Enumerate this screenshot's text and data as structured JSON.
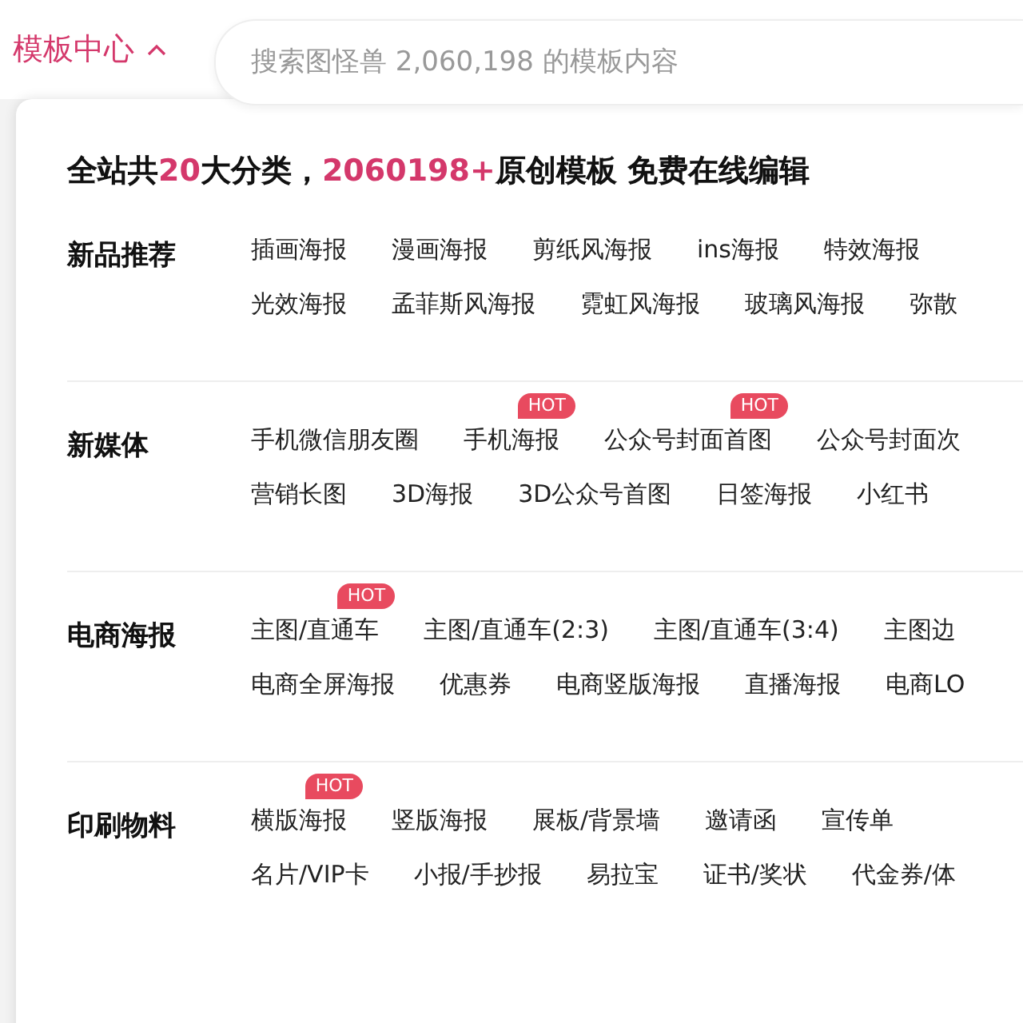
{
  "nav": {
    "label": "模板中心",
    "expanded": true
  },
  "search": {
    "placeholder": "搜索图怪兽 2,060,198 的模板内容"
  },
  "headline": [
    {
      "text": "全站共",
      "highlight": false
    },
    {
      "text": "20",
      "highlight": true
    },
    {
      "text": "大分类，",
      "highlight": false
    },
    {
      "text": "2060198+",
      "highlight": true
    },
    {
      "text": "原创模板 免费在线编辑",
      "highlight": false
    }
  ],
  "categories": [
    {
      "title": "新品推荐",
      "line_1": [
        {
          "label": "插画海报"
        },
        {
          "label": "漫画海报"
        },
        {
          "label": "剪纸风海报"
        },
        {
          "label": "ins海报"
        },
        {
          "label": "特效海报"
        }
      ],
      "line_2": [
        {
          "label": "光效海报"
        },
        {
          "label": "孟菲斯风海报"
        },
        {
          "label": "霓虹风海报"
        },
        {
          "label": "玻璃风海报"
        },
        {
          "label": "弥散"
        }
      ]
    },
    {
      "title": "新媒体",
      "line_1": [
        {
          "label": "手机微信朋友圈"
        },
        {
          "label": "手机海报",
          "badge": "HOT"
        },
        {
          "label": "公众号封面首图",
          "badge": "HOT"
        },
        {
          "label": "公众号封面次"
        }
      ],
      "line_2": [
        {
          "label": "营销长图"
        },
        {
          "label": "3D海报"
        },
        {
          "label": "3D公众号首图"
        },
        {
          "label": "日签海报"
        },
        {
          "label": "小红书"
        }
      ]
    },
    {
      "title": "电商海报",
      "line_1": [
        {
          "label": "主图/直通车",
          "badge": "HOT"
        },
        {
          "label": "主图/直通车(2:3)"
        },
        {
          "label": "主图/直通车(3:4)"
        },
        {
          "label": "主图边"
        }
      ],
      "line_2": [
        {
          "label": "电商全屏海报"
        },
        {
          "label": "优惠券"
        },
        {
          "label": "电商竖版海报"
        },
        {
          "label": "直播海报"
        },
        {
          "label": "电商LO"
        }
      ]
    },
    {
      "title": "印刷物料",
      "line_1": [
        {
          "label": "横版海报",
          "badge": "HOT"
        },
        {
          "label": "竖版海报"
        },
        {
          "label": "展板/背景墙"
        },
        {
          "label": "邀请函"
        },
        {
          "label": "宣传单"
        }
      ],
      "line_2": [
        {
          "label": "名片/VIP卡"
        },
        {
          "label": "小报/手抄报"
        },
        {
          "label": "易拉宝"
        },
        {
          "label": "证书/奖状"
        },
        {
          "label": "代金券/体"
        }
      ]
    }
  ]
}
